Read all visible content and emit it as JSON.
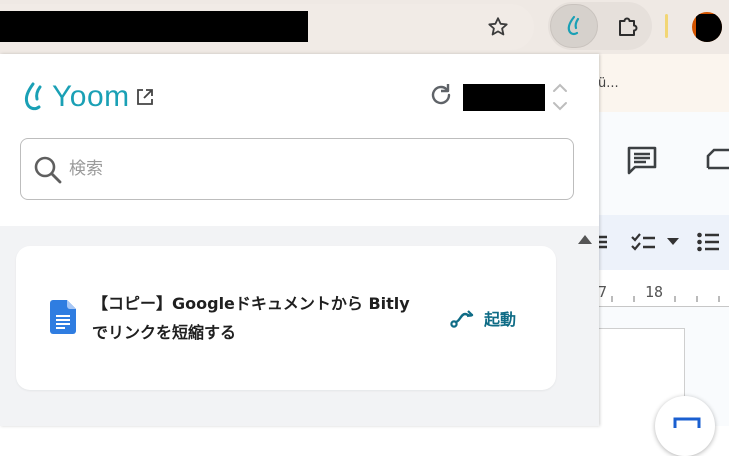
{
  "browser": {
    "icons": {
      "bookmark": "star-icon",
      "active_extension": "yoom-extension-icon",
      "extensions_menu": "puzzle-icon"
    }
  },
  "background_doc": {
    "strip_text": "ü...",
    "ruler_numbers": [
      "7",
      "18"
    ]
  },
  "popup": {
    "brand": {
      "name": "Yoom",
      "color": "#1aa0b5"
    },
    "search": {
      "placeholder": "検索",
      "value": ""
    },
    "flows": [
      {
        "title": "【コピー】Googleドキュメントから Bitlyでリンクを短縮する",
        "icon": "google-docs-icon",
        "action_label": "起動",
        "action_color": "#0f6c86"
      }
    ]
  }
}
